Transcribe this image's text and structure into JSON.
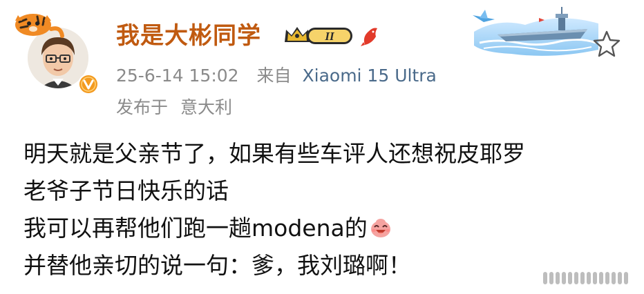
{
  "post": {
    "author": {
      "name": "我是大彬同学",
      "vip_level": "II",
      "verified_icon": "verified-v-icon"
    },
    "timestamp": "25-6-14 15:02",
    "source_prefix": "来自",
    "device": "Xiaomi 15 Ultra",
    "location_prefix": "发布于",
    "location": "意大利",
    "body_lines": [
      "明天就是父亲节了，如果有些车评人还想祝皮耶罗",
      "老爷子节日快乐的话",
      "我可以再帮他们跑一趟modena的",
      "并替他亲切的说一句：爹，我刘璐啊！"
    ],
    "emoji": "laughing-emoji"
  },
  "colors": {
    "username": "#c05a10",
    "meta": "#8a8a8a",
    "body_text": "#111111",
    "vip_gold": "#d4a017"
  },
  "icons": {
    "follow": "star-outline-icon",
    "decoration": "aircraft-carrier-card-decoration",
    "fish": "red-fish-icon"
  }
}
